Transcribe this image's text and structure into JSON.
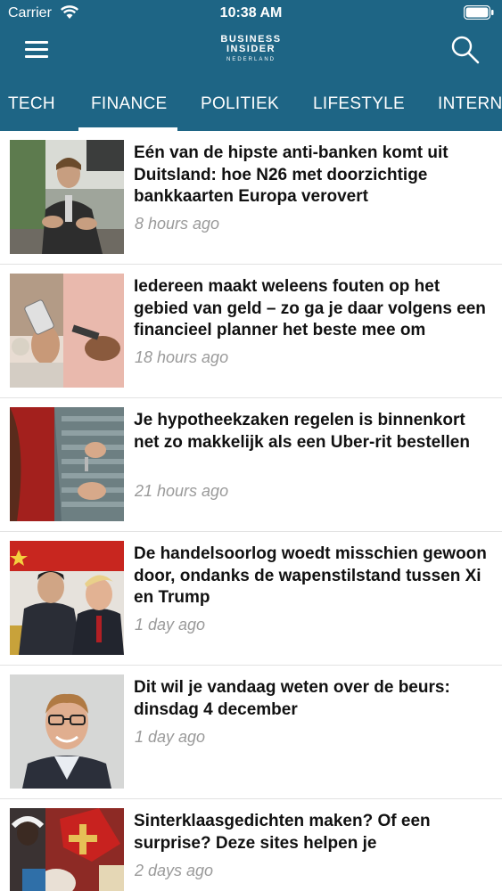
{
  "status_bar": {
    "carrier": "Carrier",
    "time": "10:38 AM"
  },
  "header": {
    "logo_line1": "BUSINESS",
    "logo_line2": "INSIDER",
    "logo_line3": "NEDERLAND",
    "icons": {
      "menu": "hamburger-menu-icon",
      "search": "search-icon"
    }
  },
  "tabs": [
    {
      "label": "TECH"
    },
    {
      "label": "FINANCE",
      "active": true
    },
    {
      "label": "POLITIEK"
    },
    {
      "label": "LIFESTYLE"
    },
    {
      "label": "INTERNA"
    }
  ],
  "articles": [
    {
      "headline": "Eén van de hipste anti-banken komt uit Duitsland: hoe N26 met doorzichtige bankkaarten Europa verovert",
      "time": "8 hours ago"
    },
    {
      "headline": "Iedereen maakt weleens fouten op het gebied van geld – zo ga je daar volgens een financieel planner het beste mee om",
      "time": "18 hours ago"
    },
    {
      "headline": "Je hypotheekzaken regelen is binnenkort net zo makkelijk als een Uber-rit bestellen",
      "time": "21 hours ago"
    },
    {
      "headline": "De handelsoorlog woedt misschien gewoon door, ondanks de wapenstilstand tussen Xi en Trump",
      "time": "1 day ago"
    },
    {
      "headline": "Dit wil je vandaag weten over de beurs: dinsdag 4 december",
      "time": "1 day ago"
    },
    {
      "headline": "Sinterklaasgedichten maken? Of een surprise? Deze sites helpen je",
      "time": "2 days ago"
    }
  ],
  "colors": {
    "header_bg": "#1e6585",
    "text": "#111111",
    "time_gray": "#9a9a9a",
    "divider": "#e2e2e2"
  }
}
